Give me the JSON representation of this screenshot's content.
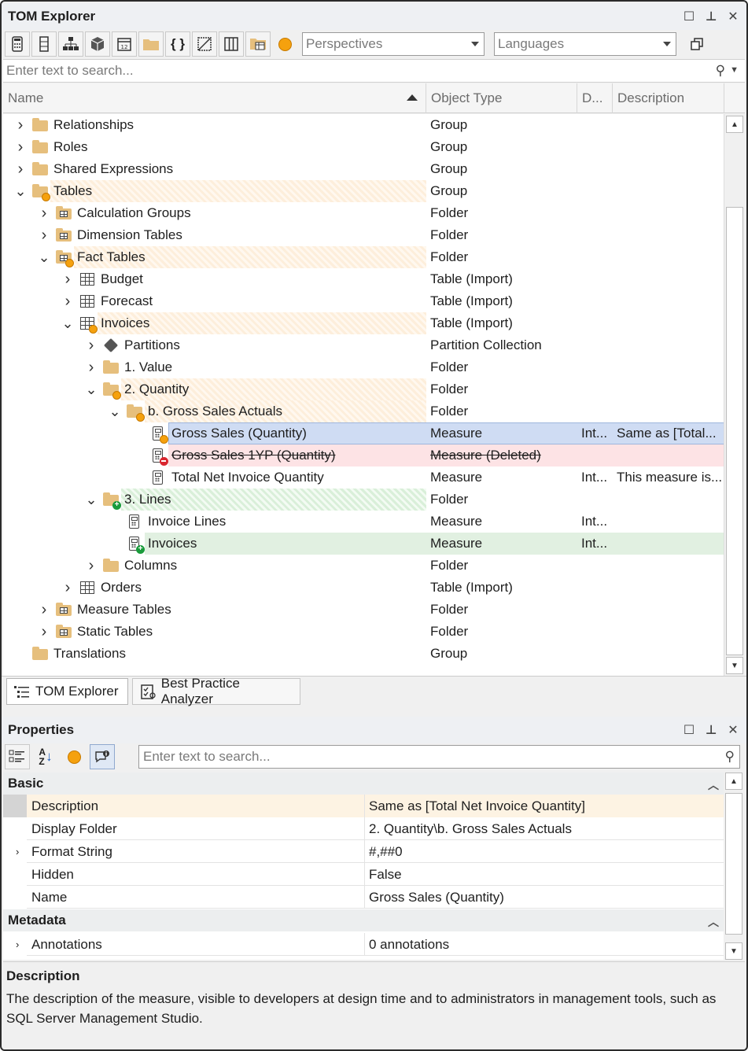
{
  "tom": {
    "title": "TOM Explorer",
    "perspectives_placeholder": "Perspectives",
    "languages_placeholder": "Languages",
    "search_placeholder": "Enter text to search...",
    "columns": {
      "name": "Name",
      "object_type": "Object Type",
      "display_folder": "D...",
      "description": "Description"
    },
    "rows": [
      {
        "name": "Relationships",
        "type": "Group",
        "d": "",
        "desc": ""
      },
      {
        "name": "Roles",
        "type": "Group",
        "d": "",
        "desc": ""
      },
      {
        "name": "Shared Expressions",
        "type": "Group",
        "d": "",
        "desc": ""
      },
      {
        "name": "Tables",
        "type": "Group",
        "d": "",
        "desc": ""
      },
      {
        "name": "Calculation Groups",
        "type": "Folder",
        "d": "",
        "desc": ""
      },
      {
        "name": "Dimension Tables",
        "type": "Folder",
        "d": "",
        "desc": ""
      },
      {
        "name": "Fact Tables",
        "type": "Folder",
        "d": "",
        "desc": ""
      },
      {
        "name": "Budget",
        "type": "Table (Import)",
        "d": "",
        "desc": ""
      },
      {
        "name": "Forecast",
        "type": "Table (Import)",
        "d": "",
        "desc": ""
      },
      {
        "name": "Invoices",
        "type": "Table (Import)",
        "d": "",
        "desc": ""
      },
      {
        "name": "Partitions",
        "type": "Partition Collection",
        "d": "",
        "desc": ""
      },
      {
        "name": "1. Value",
        "type": "Folder",
        "d": "",
        "desc": ""
      },
      {
        "name": "2. Quantity",
        "type": "Folder",
        "d": "",
        "desc": ""
      },
      {
        "name": "b. Gross Sales Actuals",
        "type": "Folder",
        "d": "",
        "desc": ""
      },
      {
        "name": "Gross Sales (Quantity)",
        "type": "Measure",
        "d": "Int...",
        "desc": "Same as [Total..."
      },
      {
        "name": "Gross Sales 1YP (Quantity)",
        "type": "Measure (Deleted)",
        "d": "",
        "desc": ""
      },
      {
        "name": "Total Net Invoice Quantity",
        "type": "Measure",
        "d": "Int...",
        "desc": "This measure is..."
      },
      {
        "name": "3. Lines",
        "type": "Folder",
        "d": "",
        "desc": ""
      },
      {
        "name": "Invoice Lines",
        "type": "Measure",
        "d": "Int...",
        "desc": ""
      },
      {
        "name": "Invoices",
        "type": "Measure",
        "d": "Int...",
        "desc": ""
      },
      {
        "name": "Columns",
        "type": "Folder",
        "d": "",
        "desc": ""
      },
      {
        "name": "Orders",
        "type": "Table (Import)",
        "d": "",
        "desc": ""
      },
      {
        "name": "Measure Tables",
        "type": "Folder",
        "d": "",
        "desc": ""
      },
      {
        "name": "Static Tables",
        "type": "Folder",
        "d": "",
        "desc": ""
      },
      {
        "name": "Translations",
        "type": "Group",
        "d": "",
        "desc": ""
      }
    ],
    "tabs": [
      "TOM Explorer",
      "Best Practice Analyzer"
    ]
  },
  "properties": {
    "title": "Properties",
    "search_placeholder": "Enter text to search...",
    "categories": [
      "Basic",
      "Metadata"
    ],
    "basic": [
      {
        "name": "Description",
        "value": "Same as [Total Net Invoice Quantity]"
      },
      {
        "name": "Display Folder",
        "value": "2. Quantity\\b. Gross Sales Actuals"
      },
      {
        "name": "Format String",
        "value": "#,##0"
      },
      {
        "name": "Hidden",
        "value": "False"
      },
      {
        "name": "Name",
        "value": "Gross Sales (Quantity)"
      }
    ],
    "metadata": [
      {
        "name": "Annotations",
        "value": "0 annotations"
      }
    ],
    "desc_title": "Description",
    "desc_text": "The description of the measure, visible to developers at design time and to administrators in management tools, such as SQL Server Management Studio."
  }
}
